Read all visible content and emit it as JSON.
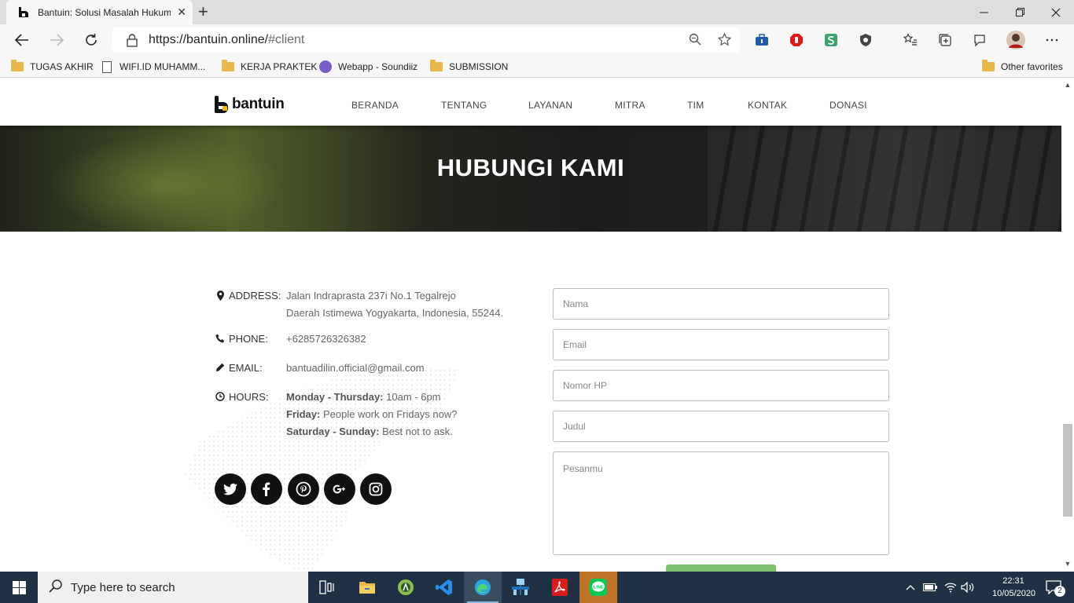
{
  "browser": {
    "tab_title": "Bantuin: Solusi Masalah Hukumnya",
    "tab_close": "✕",
    "new_tab": "+",
    "url_domain": "https://bantuin.online/",
    "url_path": "#client",
    "favorites": [
      {
        "label": "TUGAS AKHIR",
        "icon": "folder-icon"
      },
      {
        "label": "WIFI.ID MUHAMM...",
        "icon": "document-icon"
      },
      {
        "label": "KERJA PRAKTEK",
        "icon": "folder-icon"
      },
      {
        "label": "Webapp - Soundiiz",
        "icon": "soundiiz-icon"
      },
      {
        "label": "SUBMISSION",
        "icon": "folder-icon"
      }
    ],
    "other_favorites": "Other favorites"
  },
  "site": {
    "brand": "bantuin",
    "nav": [
      "BERANDA",
      "TENTANG",
      "LAYANAN",
      "MITRA",
      "TIM",
      "KONTAK",
      "DONASI"
    ],
    "hero_title": "HUBUNGI KAMI",
    "contact": {
      "address_label": "ADDRESS:",
      "address_line1": "Jalan Indraprasta 237i No.1 Tegalrejo",
      "address_line2": "Daerah Istimewa Yogyakarta, Indonesia, 55244.",
      "phone_label": "PHONE:",
      "phone_value": "+6285726326382",
      "email_label": "EMAIL:",
      "email_value": "bantuadilin.official@gmail.com",
      "hours_label": "HOURS:",
      "hours": [
        {
          "day": "Monday - Thursday:",
          "text": "10am - 6pm"
        },
        {
          "day": "Friday:",
          "text": "People work on Fridays now?"
        },
        {
          "day": "Saturday - Sunday:",
          "text": "Best not to ask."
        }
      ]
    },
    "social": [
      "twitter-icon",
      "facebook-icon",
      "pinterest-icon",
      "google-plus-icon",
      "instagram-icon"
    ],
    "form": {
      "name_placeholder": "Nama",
      "email_placeholder": "Email",
      "phone_placeholder": "Nomor HP",
      "subject_placeholder": "Judul",
      "message_placeholder": "Pesanmu"
    }
  },
  "taskbar": {
    "search_placeholder": "Type here to search",
    "time": "22:31",
    "date": "10/05/2020",
    "notifications": "2"
  },
  "colors": {
    "taskbar": "#1f3142",
    "button_green": "#7cc26c",
    "brand_yellow": "#f5b800"
  }
}
